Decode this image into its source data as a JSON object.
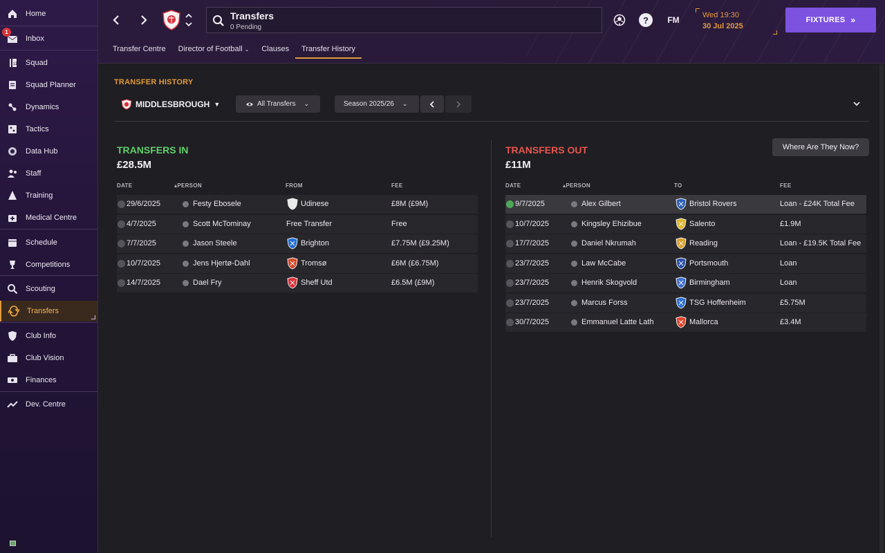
{
  "sidebar": {
    "items": [
      {
        "label": "Home",
        "icon": "home-icon"
      },
      {
        "label": "Inbox",
        "icon": "inbox-icon",
        "badge": "1"
      },
      {
        "label": "Squad",
        "icon": "squad-icon"
      },
      {
        "label": "Squad Planner",
        "icon": "squad-planner-icon"
      },
      {
        "label": "Dynamics",
        "icon": "dynamics-icon"
      },
      {
        "label": "Tactics",
        "icon": "tactics-icon"
      },
      {
        "label": "Data Hub",
        "icon": "data-hub-icon"
      },
      {
        "label": "Staff",
        "icon": "staff-icon"
      },
      {
        "label": "Training",
        "icon": "training-icon"
      },
      {
        "label": "Medical Centre",
        "icon": "medical-icon"
      },
      {
        "label": "Schedule",
        "icon": "calendar-icon"
      },
      {
        "label": "Competitions",
        "icon": "trophy-icon"
      },
      {
        "label": "Scouting",
        "icon": "search-icon"
      },
      {
        "label": "Transfers",
        "icon": "transfers-icon",
        "active": true
      },
      {
        "label": "Club Info",
        "icon": "shield-icon"
      },
      {
        "label": "Club Vision",
        "icon": "briefcase-icon"
      },
      {
        "label": "Finances",
        "icon": "money-icon"
      },
      {
        "label": "Dev. Centre",
        "icon": "dev-centre-icon"
      }
    ]
  },
  "header": {
    "title": "Transfers",
    "subtitle": "0 Pending",
    "help": "?",
    "fm_label": "FM",
    "date_line1": "Wed 19:30",
    "date_line2": "30 Jul 2025",
    "fixtures_label": "FIXTURES",
    "tabs": [
      {
        "label": "Transfer Centre"
      },
      {
        "label": "Director of Football"
      },
      {
        "label": "Clauses"
      },
      {
        "label": "Transfer History",
        "active": true
      }
    ]
  },
  "filters": {
    "section_title": "TRANSFER HISTORY",
    "club": "MIDDLESBROUGH",
    "view": "All Transfers",
    "season": "Season 2025/26"
  },
  "transfers_in": {
    "title": "TRANSFERS IN",
    "total": "£28.5M",
    "title_color": "#5fd16a",
    "columns": {
      "date": "DATE",
      "person": "PERSON",
      "from": "FROM",
      "fee": "FEE"
    },
    "rows": [
      {
        "date": "29/6/2025",
        "person": "Festy Ebosele",
        "club": "Udinese",
        "fee": "£8M (£9M)",
        "crest_color": "#e8e8e8"
      },
      {
        "date": "4/7/2025",
        "person": "Scott McTominay",
        "club": "Free Transfer",
        "fee": "Free",
        "crest_color": ""
      },
      {
        "date": "7/7/2025",
        "person": "Jason Steele",
        "club": "Brighton",
        "fee": "£7.75M (£9.25M)",
        "crest_color": "#1f6fd1"
      },
      {
        "date": "10/7/2025",
        "person": "Jens Hjertø-Dahl",
        "club": "Tromsø",
        "fee": "£6M (£6.75M)",
        "crest_color": "#d44a2a"
      },
      {
        "date": "14/7/2025",
        "person": "Dael Fry",
        "club": "Sheff Utd",
        "fee": "£6.5M (£9M)",
        "crest_color": "#d8323a"
      }
    ]
  },
  "transfers_out": {
    "title": "TRANSFERS OUT",
    "total": "£11M",
    "title_color": "#e8554d",
    "columns": {
      "date": "DATE",
      "person": "PERSON",
      "to": "TO",
      "fee": "FEE"
    },
    "where_label": "Where Are They Now?",
    "rows": [
      {
        "date": "9/7/2025",
        "person": "Alex Gilbert",
        "club": "Bristol Rovers",
        "fee": "Loan - £24K Total Fee",
        "crest_color": "#2a5fb8",
        "highlighted": true
      },
      {
        "date": "10/7/2025",
        "person": "Kingsley Ehizibue",
        "club": "Salento",
        "fee": "£1.9M",
        "crest_color": "#e0b52a"
      },
      {
        "date": "17/7/2025",
        "person": "Daniel Nkrumah",
        "club": "Reading",
        "fee": "Loan - £19.5K Total Fee",
        "crest_color": "#d8a02a"
      },
      {
        "date": "23/7/2025",
        "person": "Law McCabe",
        "club": "Portsmouth",
        "fee": "Loan",
        "crest_color": "#2a4fa8"
      },
      {
        "date": "23/7/2025",
        "person": "Henrik Skogvold",
        "club": "Birmingham",
        "fee": "Loan",
        "crest_color": "#3f6fd1"
      },
      {
        "date": "23/7/2025",
        "person": "Marcus Forss",
        "club": "TSG Hoffenheim",
        "fee": "£5.75M",
        "crest_color": "#2a6fd1"
      },
      {
        "date": "30/7/2025",
        "person": "Emmanuel Latte Lath",
        "club": "Mallorca",
        "fee": "£3.4M",
        "crest_color": "#e0442a"
      }
    ]
  },
  "colors": {
    "accent": "#e39a3b",
    "fixtures": "#7d52e0",
    "sidebar_bg": "#2a1a42",
    "club_red": "#d8323a"
  }
}
